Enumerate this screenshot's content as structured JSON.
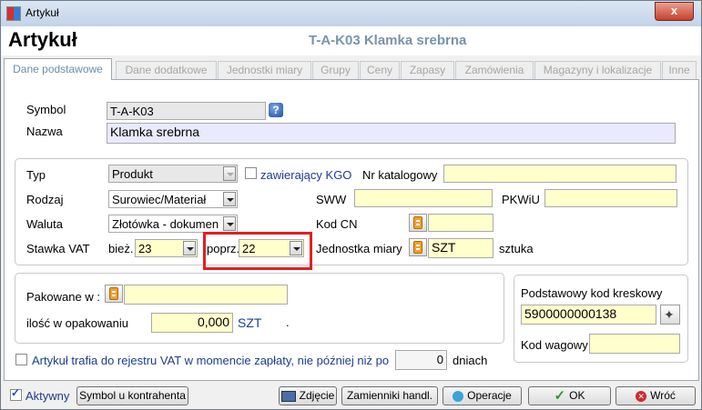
{
  "window": {
    "title": "Artykuł",
    "close_glyph": "x"
  },
  "header": {
    "title": "Artykuł",
    "record_title": "T-A-K03  Klamka srebrna"
  },
  "tabs": [
    {
      "label": "Dane podstawowe",
      "active": true
    },
    {
      "label": "Dane dodatkowe"
    },
    {
      "label": "Jednostki miary"
    },
    {
      "label": "Grupy"
    },
    {
      "label": "Ceny"
    },
    {
      "label": "Zapasy"
    },
    {
      "label": "Zamówienia"
    },
    {
      "label": "Magazyny i lokalizacje"
    },
    {
      "label": "Inne"
    }
  ],
  "basic": {
    "symbol_label": "Symbol",
    "symbol_value": "T-A-K03",
    "name_label": "Nazwa",
    "name_value": "Klamka srebrna"
  },
  "details": {
    "type_label": "Typ",
    "type_value": "Produkt",
    "kgo_label": "zawierający KGO",
    "catalog_label": "Nr katalogowy",
    "catalog_value": "",
    "kind_label": "Rodzaj",
    "kind_value": "Surowiec/Materiał",
    "sww_label": "SWW",
    "sww_value": "",
    "pkwiu_label": "PKWiU",
    "pkwiu_value": "",
    "currency_label": "Waluta",
    "currency_value": "Złotówka - dokumen",
    "cn_label": "Kod CN",
    "cn_value": "",
    "vat_label": "Stawka VAT",
    "vat_current_label": "bież.",
    "vat_current_value": "23",
    "vat_prev_label": "poprz.",
    "vat_prev_value": "22",
    "unit_label": "Jednostka miary",
    "unit_value": "SZT",
    "unit_desc": "sztuka"
  },
  "packaging": {
    "packed_label": "Pakowane w :",
    "packed_value": "",
    "qty_label": "ilość w opakowaniu",
    "qty_value": "0,000",
    "qty_unit": "SZT",
    "dot": "."
  },
  "barcode": {
    "main_label": "Podstawowy kod kreskowy",
    "main_value": "5900000000138",
    "weight_label": "Kod wagowy",
    "weight_value": ""
  },
  "vat_register": {
    "label": "Artykuł trafia do rejestru VAT w momencie zapłaty, nie później niż po",
    "days_value": "0",
    "days_label": "dniach"
  },
  "footer": {
    "active_label": "Aktywny",
    "contractor_symbol_label": "Symbol u kontrahenta",
    "photo_label": "Zdjęcie",
    "substitutes_label": "Zamienniki handl.",
    "operations_label": "Operacje",
    "ok_label": "OK",
    "back_label": "Wróć"
  },
  "colors": {
    "highlight": "#e02020",
    "field_yellow": "#ffffcc",
    "title_blue": "#7a92ad"
  }
}
